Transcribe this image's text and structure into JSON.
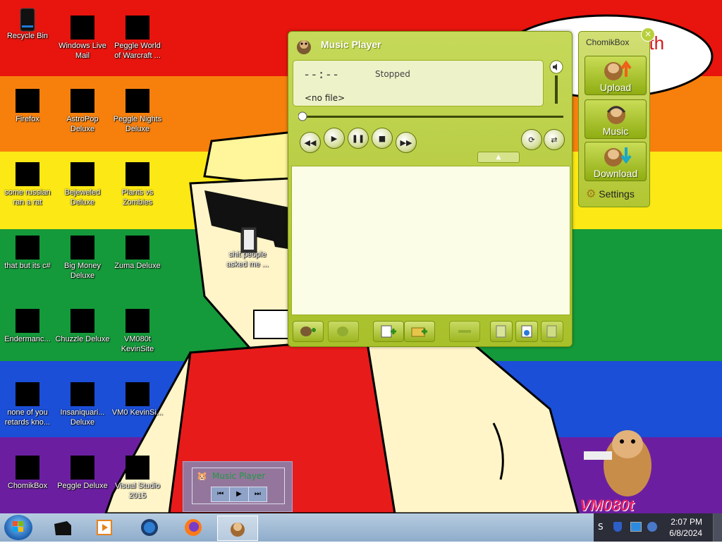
{
  "desktop": {
    "icons": [
      {
        "label": "Recycle Bin"
      },
      {
        "label": "Windows Live Mail"
      },
      {
        "label": "Peggle World of Warcraft ..."
      },
      {
        "label": "Firefox"
      },
      {
        "label": "AstroPop Deluxe"
      },
      {
        "label": "Peggle Nights Deluxe"
      },
      {
        "label": "some russian ran a rat"
      },
      {
        "label": "Bejeweled Deluxe"
      },
      {
        "label": "Plants vs Zombies"
      },
      {
        "label": "that but its c#"
      },
      {
        "label": "Big Money Deluxe"
      },
      {
        "label": "Zuma Deluxe"
      },
      {
        "label": "Endermanc..."
      },
      {
        "label": "Chuzzle Deluxe"
      },
      {
        "label": "VM080t KevinSite"
      },
      {
        "label": "none of you retards kno..."
      },
      {
        "label": "Insaniquari... Deluxe"
      },
      {
        "label": "VM0 KevinSi..."
      },
      {
        "label": "ChomikBox"
      },
      {
        "label": "Peggle Deluxe"
      },
      {
        "label": "Visual Studio 2015"
      },
      {
        "label": "shit people asked me ..."
      }
    ],
    "wallpaper_text": "VM080t",
    "speech_text": "nth"
  },
  "music_player": {
    "title": "Music Player",
    "time": "--:--",
    "status": "Stopped",
    "file": "<no file>",
    "seek_progress": 0
  },
  "chomikbox": {
    "title": "ChomikBox",
    "close": "×",
    "upload": "Upload",
    "music": "Music",
    "download": "Download",
    "settings": "Settings"
  },
  "mini_player": {
    "title": "Music Player",
    "prev": "⏮",
    "play": "▶",
    "next": "⏭"
  },
  "taskbar": {
    "time": "2:07 PM",
    "date": "6/8/2024",
    "tray_text": "S"
  },
  "colors": {
    "player_green": "#a8c02a",
    "taskbar": "#8eaccb"
  }
}
